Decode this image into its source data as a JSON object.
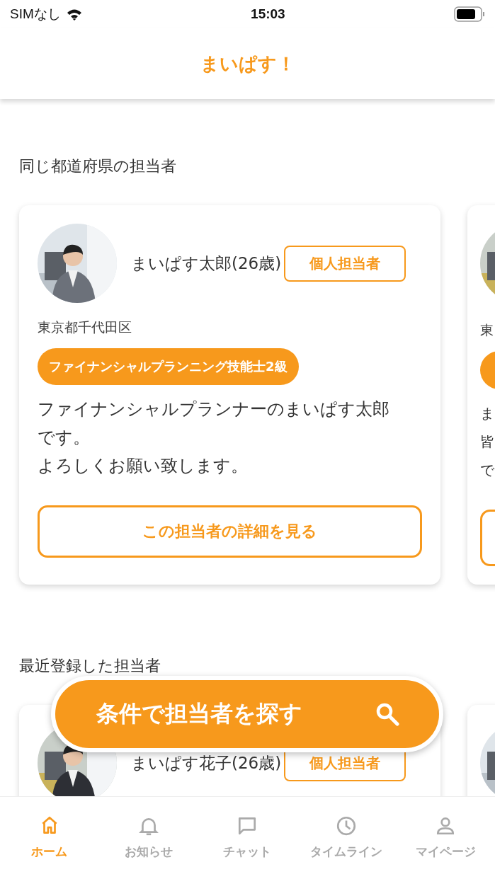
{
  "status_bar": {
    "carrier": "SIMなし",
    "time": "15:03"
  },
  "header": {
    "title": "まいぱす！"
  },
  "sections": [
    {
      "title": "同じ都道府県の担当者",
      "cards": [
        {
          "kind": "full",
          "name": "まいぱす太郎(26歳)",
          "badge": "個人担当者",
          "location": "東京都千代田区",
          "qualification": "ファイナンシャルプランニング技能士2級",
          "description": [
            "ファイナンシャルプランナーのまいぱす太郎です。",
            "よろしくお願い致します。"
          ],
          "button": "この担当者の詳細を見る"
        },
        {
          "kind": "partial",
          "location": "東",
          "description": [
            "ま",
            "皆",
            "で"
          ]
        }
      ]
    },
    {
      "title": "最近登録した担当者",
      "cards": [
        {
          "kind": "full",
          "name": "まいぱす花子(26歳)",
          "badge": "個人担当者"
        },
        {
          "kind": "partial"
        }
      ]
    }
  ],
  "search_button": {
    "label": "条件で担当者を探す"
  },
  "tabs": [
    {
      "kind": "home",
      "label": "ホーム",
      "selected": true
    },
    {
      "kind": "bell",
      "label": "お知らせ",
      "selected": false
    },
    {
      "kind": "chat",
      "label": "チャット",
      "selected": false
    },
    {
      "kind": "clock",
      "label": "タイムライン",
      "selected": false
    },
    {
      "kind": "person",
      "label": "マイページ",
      "selected": false
    }
  ]
}
